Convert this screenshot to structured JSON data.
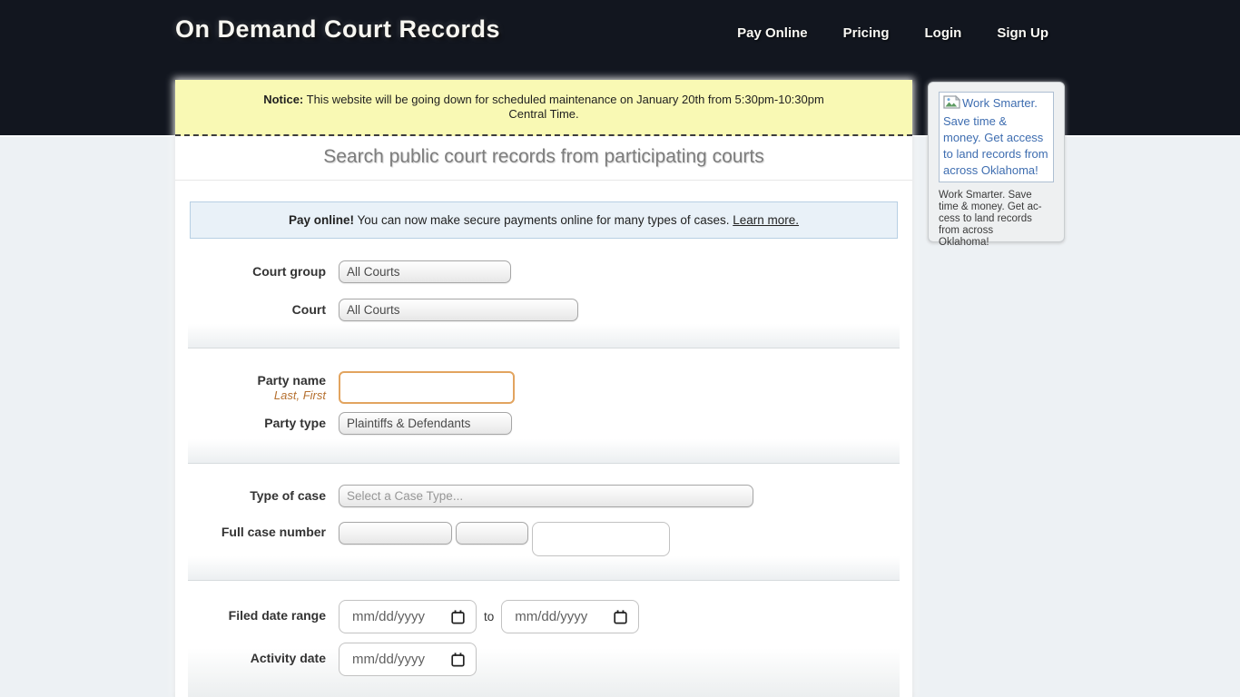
{
  "header": {
    "logo": "On Demand Court Records",
    "nav": {
      "pay_online": "Pay Online",
      "pricing": "Pricing",
      "login": "Login",
      "sign_up": "Sign Up"
    }
  },
  "notice": {
    "label": "Notice:",
    "text": "This website will be going down for scheduled maintenance on January 20th from 5:30pm-10:30pm\nCentral Time."
  },
  "main": {
    "heading": "Search public court records from participating courts",
    "pay_banner": {
      "label": "Pay online!",
      "text": "You can now make secure payments online for many types of cases.",
      "link_label": "Learn more."
    },
    "form": {
      "court_group": {
        "label": "Court group",
        "value": "All Courts"
      },
      "court": {
        "label": "Court",
        "value": "All Courts"
      },
      "party_name": {
        "label": "Party name",
        "hint": "Last, First",
        "value": ""
      },
      "party_type": {
        "label": "Party type",
        "value": "Plaintiffs & Defendants"
      },
      "case_type": {
        "label": "Type of case",
        "value": "Select a Case Type..."
      },
      "case_number": {
        "label": "Full case number",
        "part1": "",
        "part2": "",
        "part3": ""
      },
      "filed_date_range": {
        "label": "Filed date range",
        "from_placeholder": "mm/dd/yyyy",
        "separator": "to",
        "to_placeholder": "mm/dd/yyyy"
      },
      "activity_date": {
        "label": "Activity date",
        "placeholder": "mm/dd/yyyy"
      }
    }
  },
  "sidebar": {
    "ad": {
      "alt_text": "Work Smarter.\nSave time &\nmoney. Get access\nto land records from\nacross Oklahoma!",
      "caption": "Work Smarter. Save\ntime & money. Get ac-\ncess to land records\nfrom across\nOklahoma!"
    }
  },
  "colors": {
    "header_bg": "#12161f",
    "notice_bg": "#f9f9b4",
    "banner_bg": "#e9f1f8",
    "banner_border": "#b7cfe3",
    "accent_input_border": "#e2a45f",
    "hint_text": "#b5702f",
    "ad_link_blue": "#3e6db0"
  }
}
